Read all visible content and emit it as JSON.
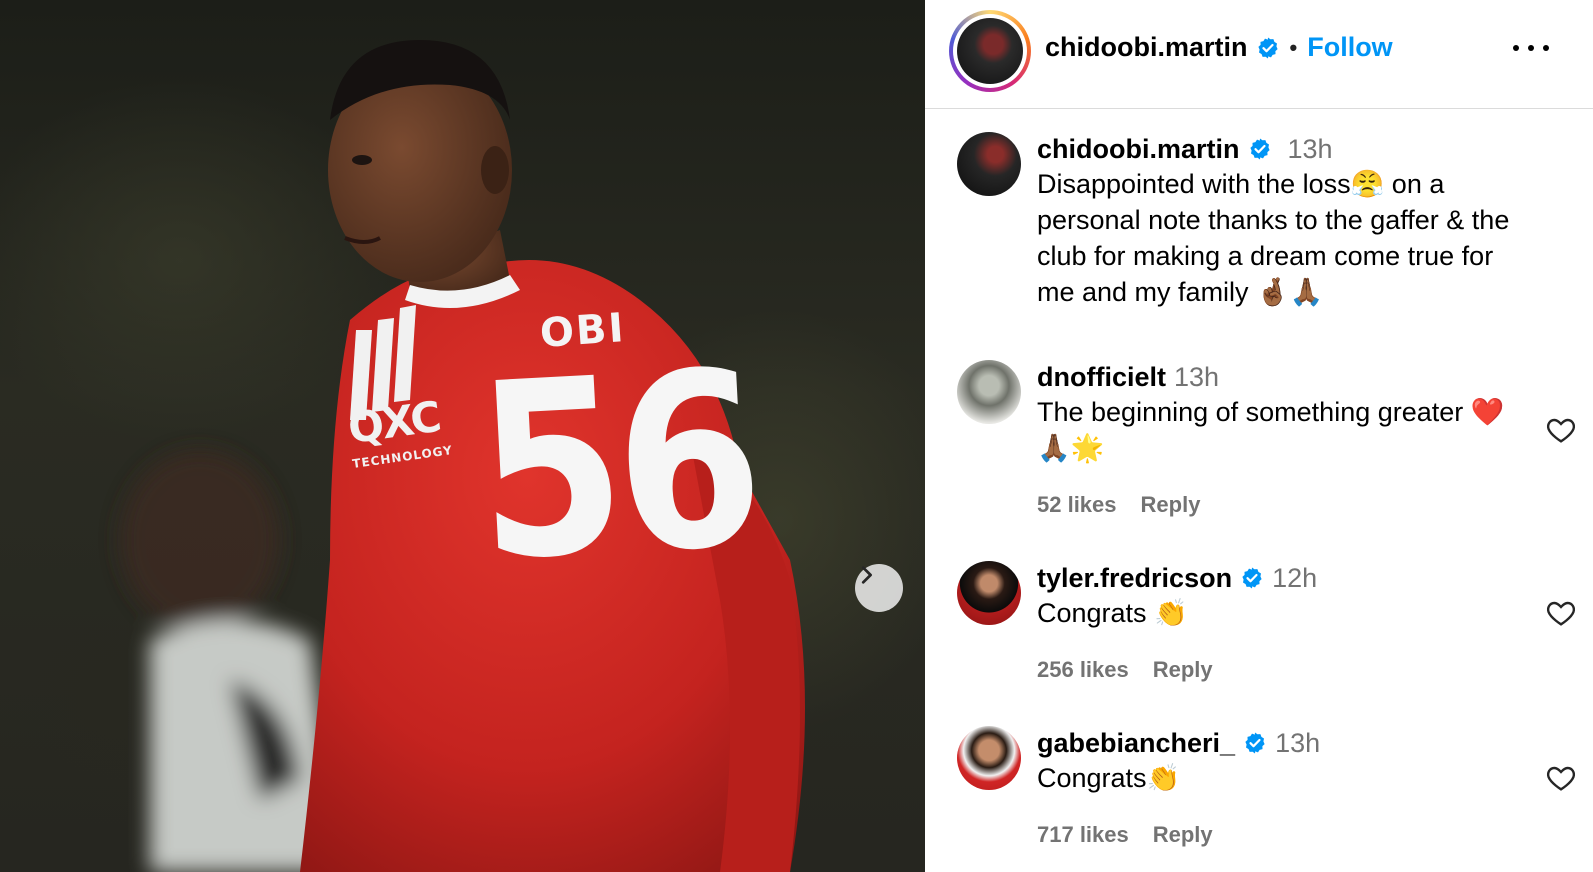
{
  "post": {
    "photo": {
      "jersey_name": "OBI",
      "jersey_number": "56",
      "sponsor_line1": "QXC",
      "sponsor_line2": "TECHNOLOGY"
    },
    "next_icon": "chevron-right-icon"
  },
  "header": {
    "username": "chidoobi.martin",
    "separator": "•",
    "follow_label": "Follow",
    "more_icon": "more-horizontal-icon"
  },
  "caption": {
    "username": "chidoobi.martin",
    "time": "13h",
    "text": "Disappointed with the loss😤 on a personal note thanks to the gaffer & the club for making a dream come true for me and my family 🤞🏾🙏🏾"
  },
  "comments": [
    {
      "username": "dnofficielt",
      "verified": false,
      "time": "13h",
      "text": "The beginning of something greater ❤️🙏🏾🌟",
      "likes": "52 likes",
      "reply_label": "Reply"
    },
    {
      "username": "tyler.fredricson",
      "verified": true,
      "time": "12h",
      "text": "Congrats 👏",
      "likes": "256 likes",
      "reply_label": "Reply"
    },
    {
      "username": "gabebiancheri_",
      "verified": true,
      "time": "13h",
      "text": "Congrats👏",
      "likes": "717 likes",
      "reply_label": "Reply"
    }
  ],
  "colors": {
    "accent": "#0095f6",
    "verified": "#0095f6",
    "muted": "#737373",
    "jersey": "#d02a25"
  }
}
